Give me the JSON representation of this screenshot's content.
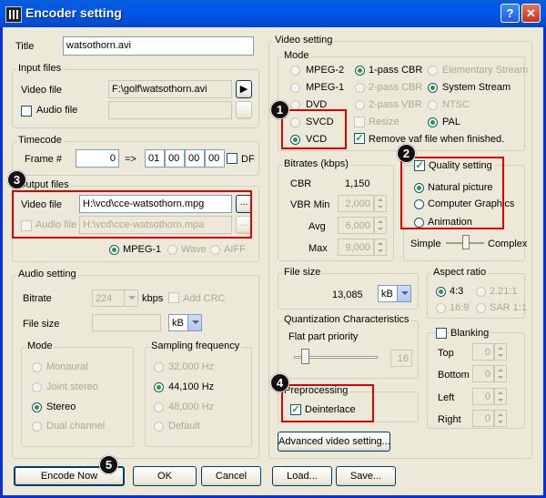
{
  "window": {
    "title": "Encoder setting",
    "help": "?",
    "close": "✕"
  },
  "title_field": {
    "label": "Title",
    "value": "watsothorn.avi"
  },
  "input_files": {
    "group": "Input files",
    "video_label": "Video file",
    "video_value": "F:\\golf\\watsothorn.avi",
    "audio_label": "Audio file",
    "audio_value": "",
    "play": "▶",
    "browse": "..."
  },
  "timecode": {
    "group": "Timecode",
    "frame_label": "Frame #",
    "frame_value": "0",
    "arrow": "=>",
    "hh": "01",
    "mm": "00",
    "ss": "00",
    "ff": "00",
    "df_label": "DF"
  },
  "output_files": {
    "group": "Output files",
    "video_label": "Video file",
    "video_value": "H:\\vcd\\cce-watsothorn.mpg",
    "audio_label": "Audio file",
    "audio_value": "H:\\vcd\\cce-watsothorn.mpa",
    "browse": "...",
    "formats": [
      "MPEG-1",
      "Wave",
      "AIFF"
    ]
  },
  "audio_setting": {
    "group": "Audio setting",
    "bitrate_label": "Bitrate",
    "bitrate_value": "224",
    "kbps": "kbps",
    "add_crc": "Add CRC",
    "filesize_label": "File size",
    "filesize_unit": "kB",
    "mode": {
      "group": "Mode",
      "options": [
        "Monaural",
        "Joint stereo",
        "Stereo",
        "Dual channel"
      ]
    },
    "sampling": {
      "group": "Sampling frequency",
      "options": [
        "32,000 Hz",
        "44,100 Hz",
        "48,000 Hz",
        "Default"
      ]
    }
  },
  "video_setting": {
    "group": "Video setting",
    "mode": {
      "group": "Mode",
      "col1": [
        "MPEG-2",
        "MPEG-1",
        "DVD",
        "SVCD",
        "VCD"
      ],
      "col2": [
        "1-pass CBR",
        "2-pass CBR",
        "2-pass VBR",
        "Resize"
      ],
      "col3": [
        "Elementary Stream",
        "System Stream",
        "NTSC",
        "PAL"
      ],
      "remove_vaf": "Remove vaf file when finished."
    },
    "bitrates": {
      "group": "Bitrates (kbps)",
      "cbr_label": "CBR",
      "cbr_value": "1,150",
      "vbr_min_label": "VBR Min",
      "vbr_min_value": "2,000",
      "avg_label": "Avg",
      "avg_value": "6,000",
      "max_label": "Max",
      "max_value": "9,000"
    },
    "quality": {
      "label": "Quality setting",
      "options": [
        "Natural picture",
        "Computer Graphics",
        "Animation"
      ],
      "simple": "Simple",
      "complex": "Complex"
    },
    "file_size": {
      "group": "File size",
      "value": "13,085",
      "unit": "kB"
    },
    "aspect": {
      "group": "Aspect ratio",
      "options": [
        "4:3",
        "2.21:1",
        "16:9",
        "SAR 1:1"
      ]
    },
    "quantization": {
      "group": "Quantization Characteristics",
      "flat_label": "Flat part priority",
      "value": "16"
    },
    "preprocessing": {
      "group": "Preprocessing",
      "deinterlace": "Deinterlace"
    },
    "blanking": {
      "label": "Blanking",
      "top": "Top",
      "bottom": "Bottom",
      "left": "Left",
      "right": "Right",
      "value": "0"
    },
    "advanced": "Advanced video setting..."
  },
  "buttons": {
    "encode": "Encode Now",
    "ok": "OK",
    "cancel": "Cancel",
    "load": "Load...",
    "save": "Save..."
  },
  "badges": [
    "1",
    "2",
    "3",
    "4",
    "5"
  ],
  "highlight_color": "#e30000"
}
